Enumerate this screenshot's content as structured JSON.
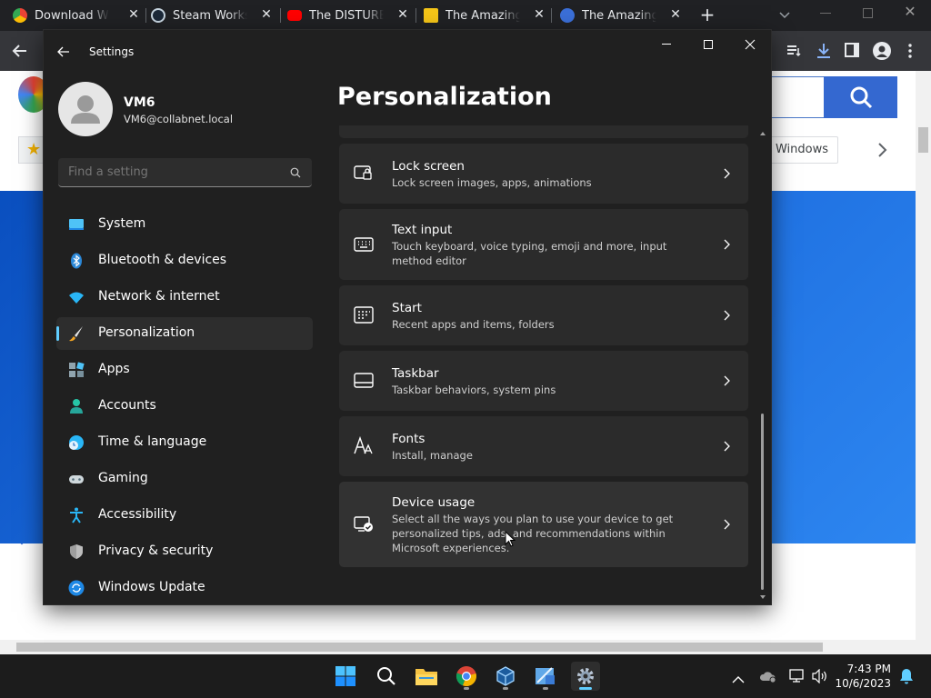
{
  "browser": {
    "tabs": [
      {
        "title": "Download Windows",
        "favicon": "chrome-icon"
      },
      {
        "title": "Steam Workshop",
        "favicon": "steam-icon"
      },
      {
        "title": "The DISTURBING",
        "favicon": "youtube-icon"
      },
      {
        "title": "The Amazing D",
        "favicon": "bookmark-icon"
      },
      {
        "title": "The Amazing D",
        "favicon": "web-icon"
      }
    ],
    "page_chip": "Windows"
  },
  "settings": {
    "window_title": "Settings",
    "user": {
      "name": "VM6",
      "email": "VM6@collabnet.local"
    },
    "search": {
      "placeholder": "Find a setting"
    },
    "page_title": "Personalization",
    "nav": [
      {
        "label": "System",
        "icon": "system-icon"
      },
      {
        "label": "Bluetooth & devices",
        "icon": "bluetooth-icon"
      },
      {
        "label": "Network & internet",
        "icon": "network-icon"
      },
      {
        "label": "Personalization",
        "icon": "personalization-brush-icon",
        "selected": true
      },
      {
        "label": "Apps",
        "icon": "apps-icon"
      },
      {
        "label": "Accounts",
        "icon": "accounts-icon"
      },
      {
        "label": "Time & language",
        "icon": "time-language-icon"
      },
      {
        "label": "Gaming",
        "icon": "gaming-icon"
      },
      {
        "label": "Accessibility",
        "icon": "accessibility-icon"
      },
      {
        "label": "Privacy & security",
        "icon": "privacy-shield-icon"
      },
      {
        "label": "Windows Update",
        "icon": "windows-update-icon"
      }
    ],
    "cards": [
      {
        "title": "Lock screen",
        "desc": "Lock screen images, apps, animations",
        "icon": "lock-screen-icon"
      },
      {
        "title": "Text input",
        "desc": "Touch keyboard, voice typing, emoji and more, input method editor",
        "icon": "keyboard-icon"
      },
      {
        "title": "Start",
        "desc": "Recent apps and items, folders",
        "icon": "start-icon"
      },
      {
        "title": "Taskbar",
        "desc": "Taskbar behaviors, system pins",
        "icon": "taskbar-icon"
      },
      {
        "title": "Fonts",
        "desc": "Install, manage",
        "icon": "fonts-icon"
      },
      {
        "title": "Device usage",
        "desc": "Select all the ways you plan to use your device to get personalized tips, ads, and recommendations within Microsoft experiences.",
        "icon": "device-usage-icon"
      }
    ],
    "accent": "#60cdff"
  },
  "taskbar": {
    "icons": [
      "start-icon",
      "search-icon",
      "file-explorer-icon",
      "chrome-icon",
      "virtualbox-icon",
      "snipping-tool-icon",
      "settings-gear-icon"
    ],
    "time": "7:43 PM",
    "date": "10/6/2023"
  }
}
